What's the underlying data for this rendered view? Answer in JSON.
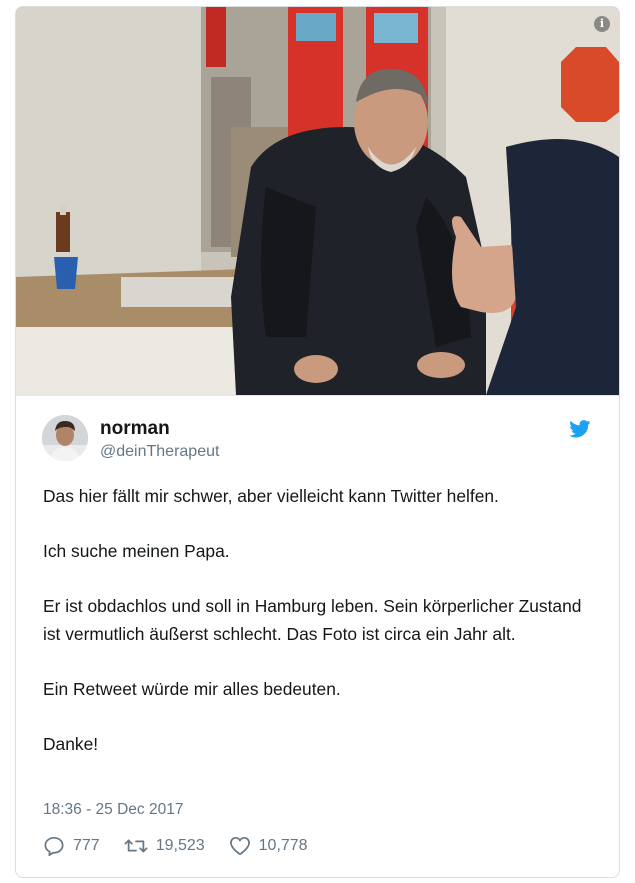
{
  "tweet": {
    "photo": {
      "description_icon": "info-icon",
      "info_glyph": "i"
    },
    "author": {
      "name": "norman",
      "handle": "@deinTherapeut",
      "avatar_icon": "avatar-icon"
    },
    "platform_icon": "twitter-bird-icon",
    "brand_color": "#1da1f2",
    "paragraphs": [
      "Das hier fällt mir schwer, aber vielleicht kann Twitter helfen.",
      "Ich suche meinen Papa.",
      "Er ist obdachlos und soll in Hamburg leben. Sein körperlicher Zustand ist vermutlich äußerst schlecht. Das Foto ist circa ein Jahr alt.",
      "Ein Retweet würde mir alles bedeuten.",
      "Danke!"
    ],
    "timestamp": "18:36 - 25 Dec 2017",
    "actions": {
      "replies": {
        "icon": "reply-icon",
        "count": "777"
      },
      "retweets": {
        "icon": "retweet-icon",
        "count": "19,523"
      },
      "likes": {
        "icon": "heart-icon",
        "count": "10,778"
      }
    }
  }
}
